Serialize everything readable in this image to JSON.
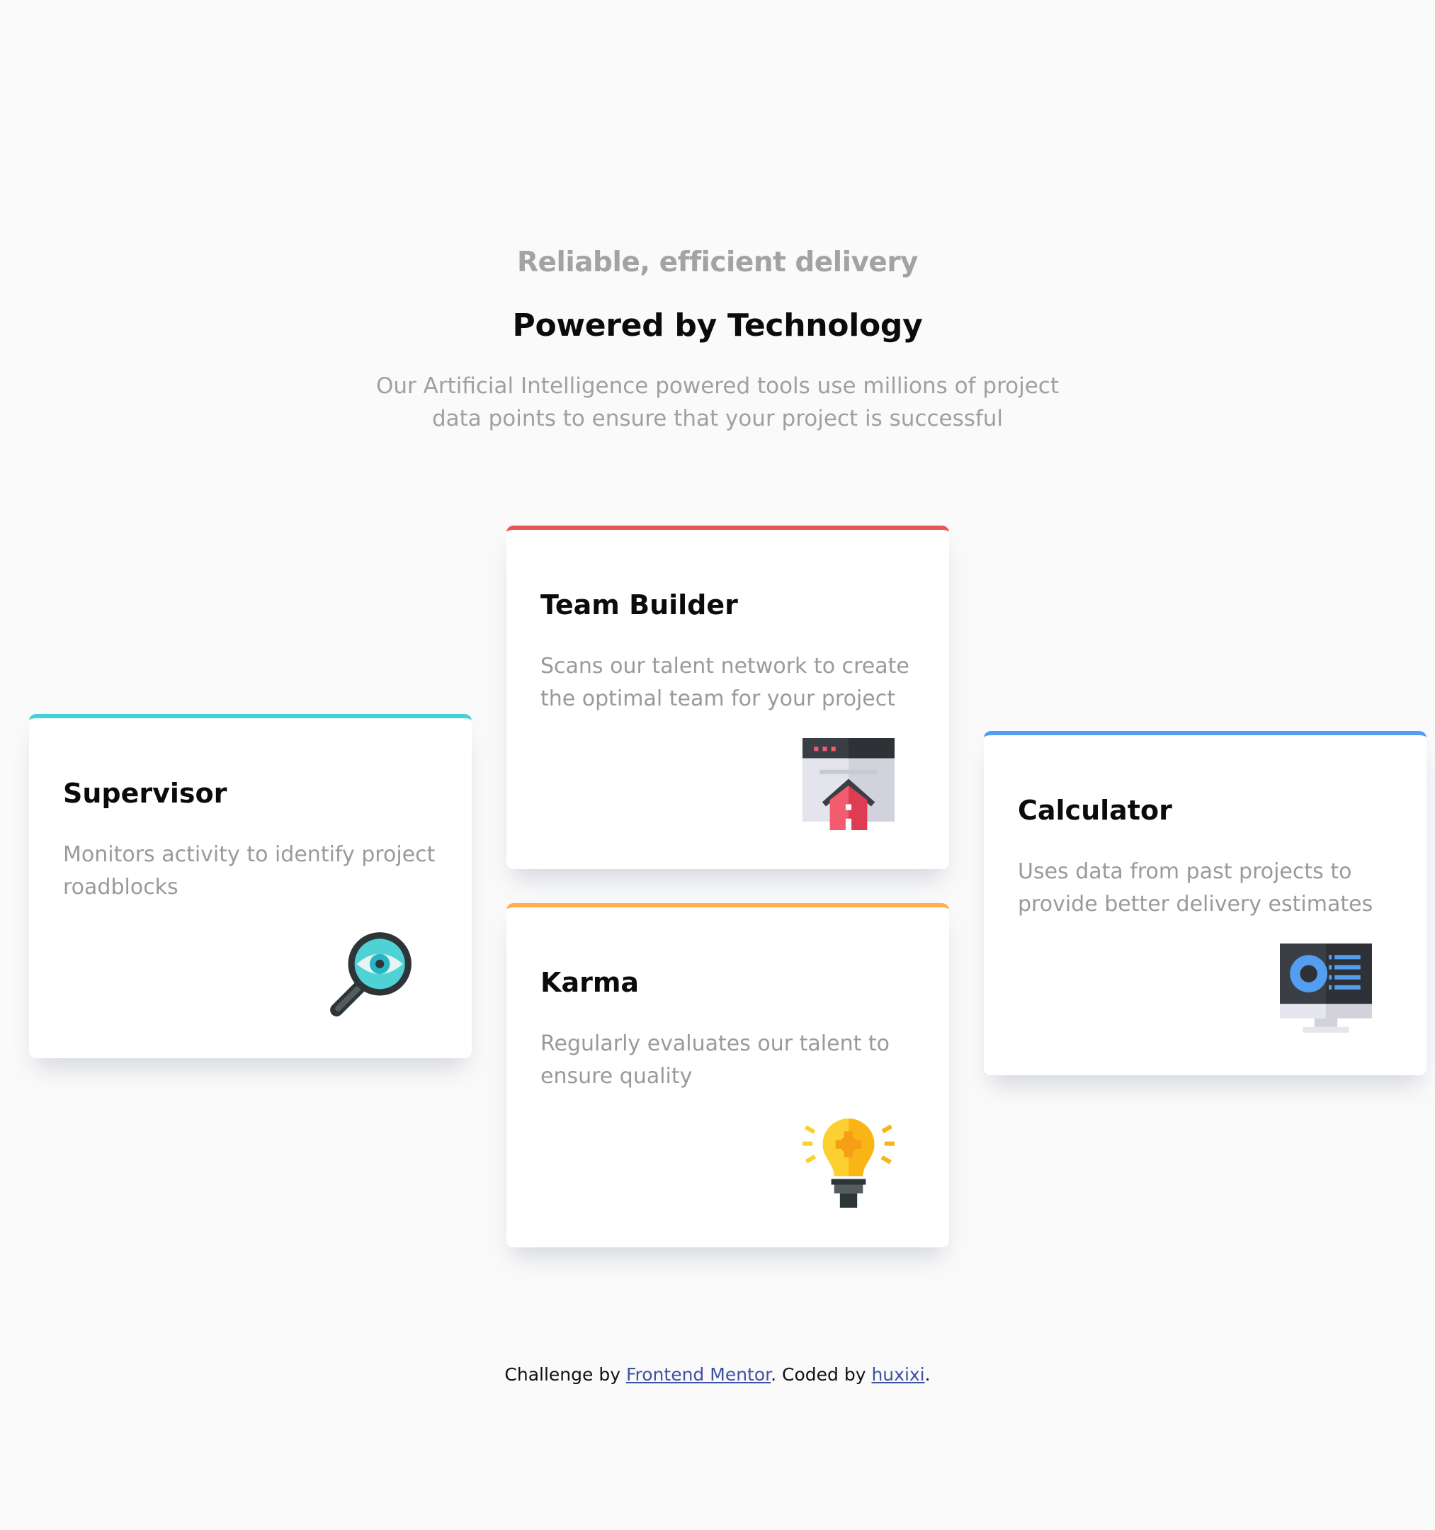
{
  "header": {
    "subtitle": "Reliable, efficient delivery",
    "title": "Powered by Technology",
    "intro": "Our Artificial Intelligence powered tools use millions of project data points to ensure that your project is successful"
  },
  "cards": [
    {
      "title": "Supervisor",
      "description": "Monitors activity to identify project roadblocks",
      "icon": "magnifier-eye-icon",
      "accent": "#44d3d2"
    },
    {
      "title": "Team Builder",
      "description": "Scans our talent network to create the optimal team for your project",
      "icon": "browser-house-icon",
      "accent": "#ea5454"
    },
    {
      "title": "Karma",
      "description": "Regularly evaluates our talent to ensure quality",
      "icon": "lightbulb-icon",
      "accent": "#fcaf4a"
    },
    {
      "title": "Calculator",
      "description": "Uses data from past projects to provide better delivery estimates",
      "icon": "monitor-chart-icon",
      "accent": "#549ef2"
    }
  ],
  "footer": {
    "prefix": "Challenge by",
    "link1": "Frontend Mentor",
    "middle": ". Coded by",
    "link2": "huxixi",
    "suffix": "."
  }
}
